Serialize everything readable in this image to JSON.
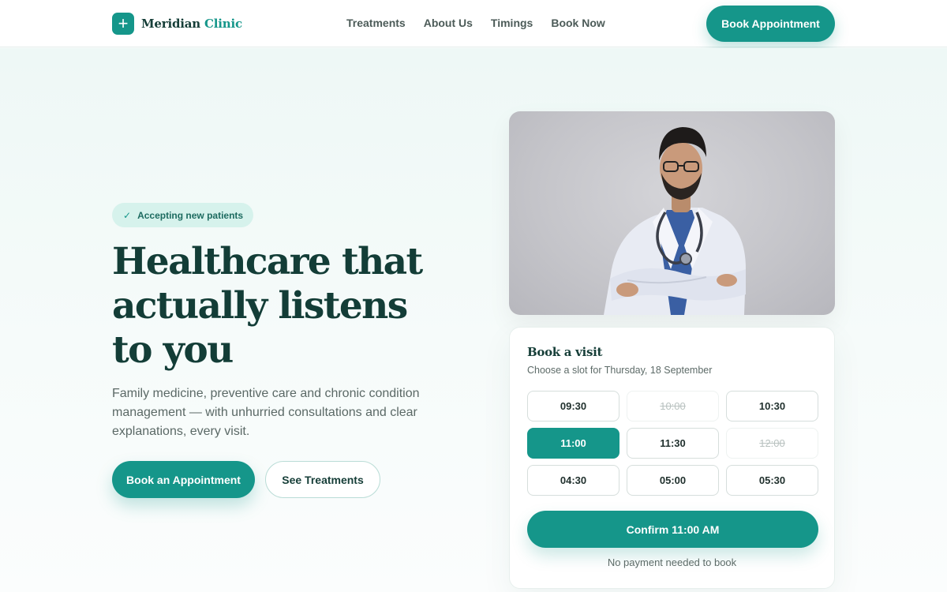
{
  "brand": {
    "name_primary": "Meridian",
    "name_accent": "Clinic",
    "logo_icon": "plus-icon",
    "accent_color": "#15968a",
    "dark_color": "#133d37"
  },
  "nav": {
    "items": [
      "Treatments",
      "About Us",
      "Timings",
      "Book Now"
    ],
    "cta_label": "Book Appointment"
  },
  "hero": {
    "badge_icon": "check-icon",
    "badge_text": "Accepting new patients",
    "headline": "Healthcare that actually listens to you",
    "subtext": "Family medicine, preventive care and chronic condition management — with unhurried consultations and clear explanations, every visit.",
    "primary_cta": "Book an Appointment",
    "secondary_cta": "See Treatments"
  },
  "booking": {
    "title": "Book a visit",
    "subtitle": "Choose a slot for Thursday, 18 September",
    "slots": [
      {
        "time": "09:30",
        "state": "available"
      },
      {
        "time": "10:00",
        "state": "unavailable"
      },
      {
        "time": "10:30",
        "state": "available"
      },
      {
        "time": "11:00",
        "state": "selected"
      },
      {
        "time": "11:30",
        "state": "available"
      },
      {
        "time": "12:00",
        "state": "unavailable"
      },
      {
        "time": "04:30",
        "state": "available"
      },
      {
        "time": "05:00",
        "state": "available"
      },
      {
        "time": "05:30",
        "state": "available"
      }
    ],
    "confirm_label": "Confirm 11:00 AM",
    "note": "No payment needed to book"
  }
}
